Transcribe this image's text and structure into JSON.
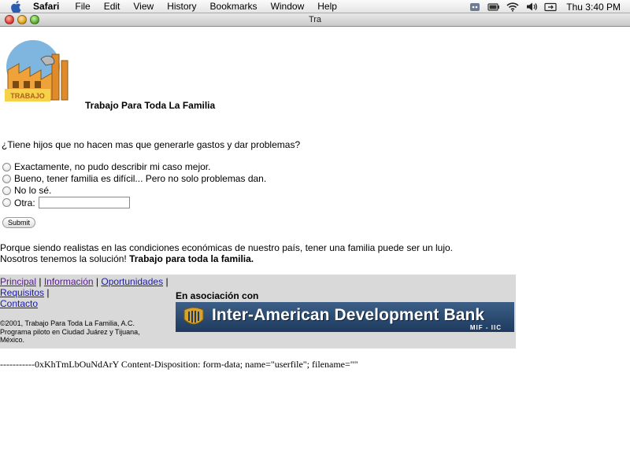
{
  "menubar": {
    "apple_icon": "apple-logo",
    "app_name": "Safari",
    "items": [
      "File",
      "Edit",
      "View",
      "History",
      "Bookmarks",
      "Window",
      "Help"
    ],
    "clock": "Thu 3:40 PM",
    "tray_icons": [
      "speech-icon",
      "battery-icon",
      "wifi-icon",
      "volume-icon",
      "display-icon"
    ]
  },
  "window": {
    "title": "Tra"
  },
  "page": {
    "site_title": "Trabajo Para Toda La Familia",
    "question": "¿Tiene hijos que no hacen mas que generarle gastos y dar problemas?",
    "options": [
      "Exactamente, no pudo describir mi caso mejor.",
      "Bueno, tener familia es difícil... Pero no solo problemas dan.",
      "No lo sé.",
      "Otra:"
    ],
    "other_value": "",
    "submit_label": "Submit",
    "promo_line1": "Porque siendo realistas en las condiciones económicas de nuestro país, tener una familia puede ser un lujo.",
    "promo_line2": "Nosotros tenemos la solución! ",
    "promo_bold": "Trabajo para toda la familia.",
    "footer": {
      "nav": [
        "Principal",
        "Información",
        "Oportunidades",
        "Requisitos",
        "Contacto"
      ],
      "separator": "|",
      "copyright_lines": [
        "©2001, Trabajo Para Toda La Familia, A.C.",
        "Programa piloto en Ciudad Juárez y Tijuana,",
        "México."
      ],
      "partner_label": "En asociación con",
      "bank_name": "Inter-American Development Bank",
      "bank_sub": "MIF - IIC"
    },
    "raw_text": "-----------0xKhTmLbOuNdArY Content-Disposition: form-data; name=\"userfile\"; filename=\"\""
  },
  "colors": {
    "link": "#1a1aa6",
    "visited_link": "#551a8b",
    "footer_bg": "#d9d9d9",
    "bank_banner": "#2a4a70"
  }
}
